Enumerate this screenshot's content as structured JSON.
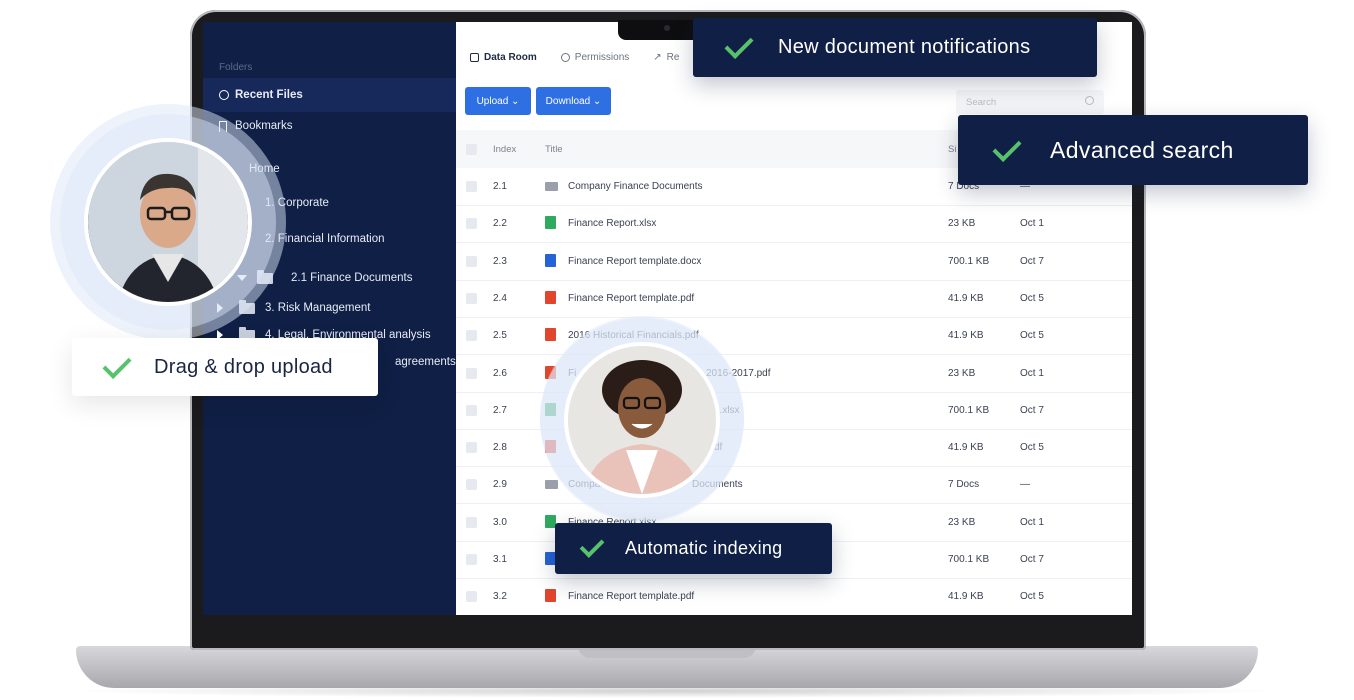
{
  "sidebar": {
    "heading": "Folders",
    "recent": "Recent Files",
    "bookmarks": "Bookmarks",
    "tree": {
      "home": "Home",
      "corporate": "1. Corporate",
      "financial": "2. Financial Information",
      "finance_docs": "2.1 Finance Documents",
      "risk": "3. Risk Management",
      "legal": "4. Legal, Environmental analysis",
      "agreements": "agreements"
    }
  },
  "tabs": {
    "data_room": "Data Room",
    "permissions": "Permissions",
    "reports": "Re"
  },
  "toolbar": {
    "upload": "Upload ⌄",
    "download": "Download ⌄",
    "search_placeholder": "Search"
  },
  "table": {
    "headers": {
      "index": "Index",
      "title": "Title",
      "size": "Si"
    },
    "rows": [
      {
        "index": "2.1",
        "title": "Company Finance Documents",
        "size": "7 Docs",
        "date": "—",
        "type": "folder"
      },
      {
        "index": "2.2",
        "title": "Finance Report.xlsx",
        "size": "23 KB",
        "date": "Oct 1",
        "type": "xlsx"
      },
      {
        "index": "2.3",
        "title": "Finance Report template.docx",
        "size": "700.1 KB",
        "date": "Oct 7",
        "type": "docx"
      },
      {
        "index": "2.4",
        "title": "Finance Report template.pdf",
        "size": "41.9 KB",
        "date": "Oct 5",
        "type": "pdf"
      },
      {
        "index": "2.5",
        "title": "2016 Historical Financials.pdf",
        "size": "41.9 KB",
        "date": "Oct 5",
        "type": "pdf"
      },
      {
        "index": "2.6",
        "title": "Fi",
        "title_tail": "2016-2017.pdf",
        "size": "23 KB",
        "date": "Oct 1",
        "type": "pdf"
      },
      {
        "index": "2.7",
        "title": "",
        "title_tail": "e.xlsx",
        "size": "700.1 KB",
        "date": "Oct 7",
        "type": "xlsx"
      },
      {
        "index": "2.8",
        "title": "",
        "title_tail": "df",
        "size": "41.9 KB",
        "date": "Oct 5",
        "type": "pdf"
      },
      {
        "index": "2.9",
        "title": "Company",
        "title_tail": "Documents",
        "size": "7 Docs",
        "date": "—",
        "type": "folder"
      },
      {
        "index": "3.0",
        "title": "Finance Report.xlsx",
        "size": "23 KB",
        "date": "Oct 1",
        "type": "xlsx"
      },
      {
        "index": "3.1",
        "title": "",
        "size": "700.1 KB",
        "date": "Oct 7",
        "type": "docx"
      },
      {
        "index": "3.2",
        "title": "Finance Report template.pdf",
        "size": "41.9 KB",
        "date": "Oct 5",
        "type": "pdf"
      }
    ]
  },
  "badges": {
    "notifications": "New document notifications",
    "search": "Advanced search",
    "drag": "Drag & drop upload",
    "indexing": "Automatic indexing"
  },
  "colors": {
    "navy": "#0f1f45",
    "accent": "#2f6fe4",
    "check": "#57c26b"
  }
}
